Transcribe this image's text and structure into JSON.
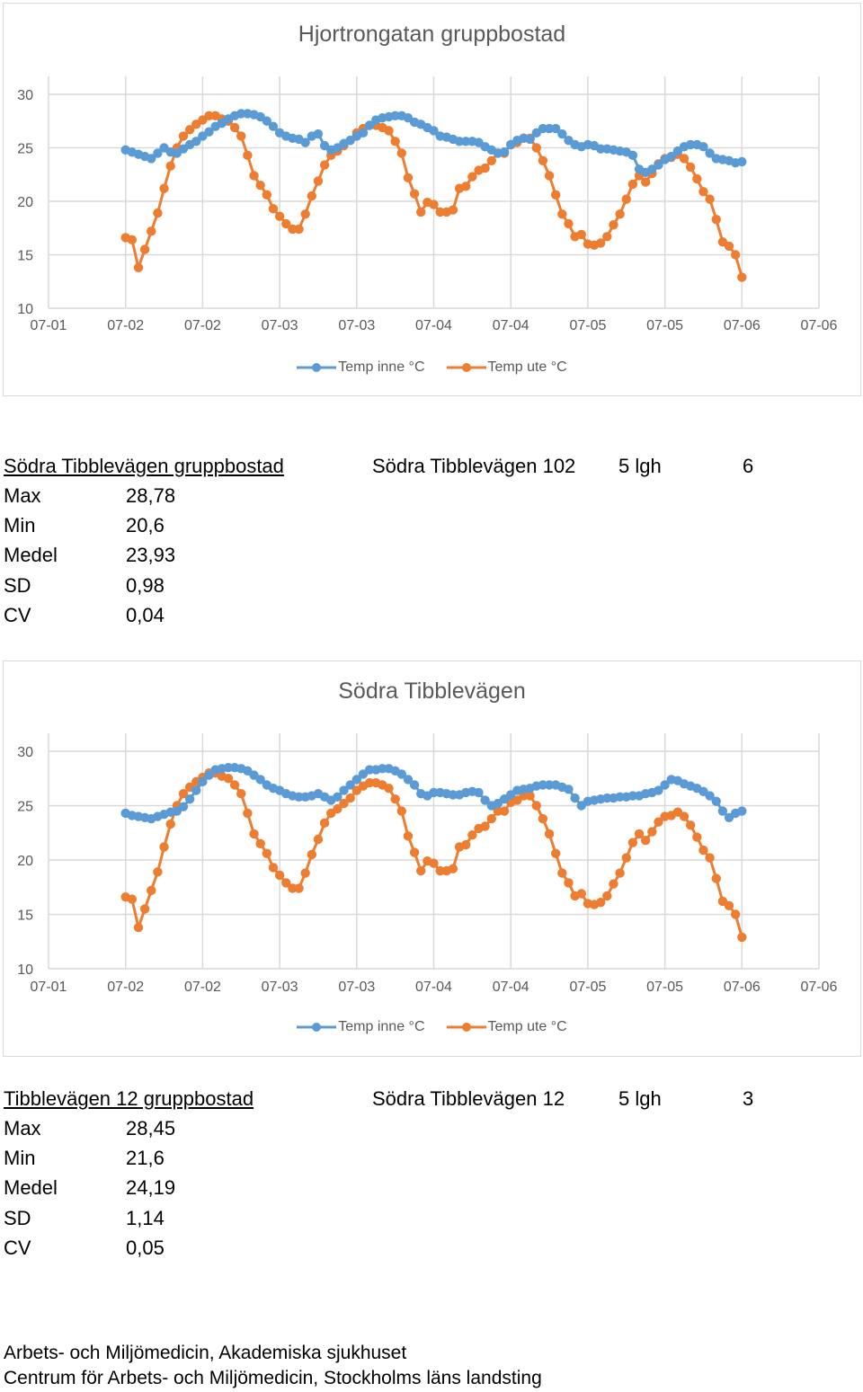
{
  "colors": {
    "inside": "#5b9bd5",
    "outside": "#ed7d31",
    "grid": "#d9d9d9",
    "axis_text": "#595959"
  },
  "chart_data": [
    {
      "type": "line",
      "title": "Hjortrongatan gruppbostad",
      "ylim": [
        10,
        30
      ],
      "yticks": [
        "10",
        "15",
        "20",
        "25",
        "30"
      ],
      "xtick_labels": [
        "07-01",
        "07-02",
        "07-02",
        "07-03",
        "07-03",
        "07-04",
        "07-04",
        "07-05",
        "07-05",
        "07-06",
        "07-06"
      ],
      "grid": true,
      "legend": "bottom",
      "series": [
        {
          "name": "Temp inne °C",
          "values": [
            24.8,
            24.6,
            24.4,
            24.2,
            24.0,
            24.5,
            25.0,
            24.6,
            24.5,
            24.9,
            25.3,
            25.6,
            26.1,
            26.5,
            27.0,
            27.3,
            27.7,
            28.0,
            28.2,
            28.2,
            28.1,
            27.9,
            27.5,
            27.0,
            26.4,
            26.1,
            25.9,
            25.8,
            25.5,
            26.1,
            26.3,
            25.2,
            24.8,
            25.0,
            25.4,
            25.7,
            26.1,
            26.4,
            27.1,
            27.6,
            27.8,
            27.9,
            28.0,
            28.0,
            27.8,
            27.4,
            27.2,
            26.9,
            26.6,
            26.1,
            26.0,
            25.8,
            25.6,
            25.6,
            25.6,
            25.5,
            25.1,
            24.8,
            24.5,
            24.6,
            25.3,
            25.7,
            25.9,
            25.8,
            26.4,
            26.8,
            26.8,
            26.8,
            26.3,
            25.7,
            25.3,
            25.1,
            25.3,
            25.2,
            24.9,
            24.9,
            24.8,
            24.7,
            24.6,
            24.3,
            23.0,
            22.7,
            23.0,
            23.4,
            23.9,
            24.2,
            24.7,
            25.1,
            25.3,
            25.3,
            25.1,
            24.5,
            24.0,
            23.9,
            23.8,
            23.6,
            23.7
          ]
        },
        {
          "name": "Temp ute °C",
          "values": [
            16.6,
            16.4,
            13.8,
            15.5,
            17.2,
            18.9,
            21.2,
            23.3,
            25.0,
            26.1,
            26.7,
            27.2,
            27.6,
            28.0,
            28.0,
            27.7,
            27.5,
            26.9,
            26.1,
            24.3,
            22.4,
            21.5,
            20.6,
            19.3,
            18.6,
            17.9,
            17.4,
            17.4,
            18.8,
            20.5,
            21.9,
            23.4,
            24.3,
            24.7,
            25.2,
            25.7,
            26.4,
            26.8,
            27.1,
            27.1,
            26.9,
            26.6,
            25.6,
            24.5,
            22.2,
            20.7,
            19.0,
            19.9,
            19.7,
            19.0,
            19.0,
            19.2,
            21.2,
            21.4,
            22.3,
            22.9,
            23.1,
            23.8,
            24.5,
            24.5,
            25.3,
            25.5,
            25.9,
            25.9,
            25.0,
            23.8,
            22.4,
            20.6,
            18.8,
            17.9,
            16.7,
            16.9,
            16.0,
            15.9,
            16.1,
            16.7,
            17.8,
            18.8,
            20.2,
            21.6,
            22.4,
            21.8,
            22.6,
            23.5,
            24.0,
            24.1,
            24.4,
            24.0,
            23.2,
            22.1,
            20.9,
            20.2,
            18.3,
            16.2,
            15.8,
            15.0,
            12.9
          ]
        }
      ]
    },
    {
      "type": "line",
      "title": "Södra Tibblevägen",
      "ylim": [
        10,
        30
      ],
      "yticks": [
        "10",
        "15",
        "20",
        "25",
        "30"
      ],
      "xtick_labels": [
        "07-01",
        "07-02",
        "07-02",
        "07-03",
        "07-03",
        "07-04",
        "07-04",
        "07-05",
        "07-05",
        "07-06",
        "07-06"
      ],
      "grid": true,
      "legend": "bottom",
      "series": [
        {
          "name": "Temp inne °C",
          "values": [
            24.3,
            24.1,
            24.0,
            23.9,
            23.8,
            24.0,
            24.2,
            24.4,
            24.5,
            24.9,
            25.6,
            26.4,
            27.2,
            27.8,
            28.3,
            28.4,
            28.5,
            28.5,
            28.4,
            28.2,
            27.8,
            27.4,
            26.9,
            26.6,
            26.4,
            26.1,
            25.9,
            25.8,
            25.8,
            25.9,
            26.1,
            25.8,
            25.5,
            25.8,
            26.4,
            26.9,
            27.4,
            27.9,
            28.3,
            28.3,
            28.4,
            28.4,
            28.2,
            27.9,
            27.4,
            26.9,
            26.1,
            25.9,
            26.2,
            26.2,
            26.1,
            26.0,
            26.0,
            26.2,
            26.3,
            26.2,
            25.5,
            25.0,
            25.2,
            25.6,
            26.0,
            26.4,
            26.5,
            26.6,
            26.8,
            26.9,
            26.9,
            26.9,
            26.7,
            26.5,
            25.7,
            25.0,
            25.4,
            25.5,
            25.6,
            25.7,
            25.7,
            25.8,
            25.8,
            25.9,
            25.9,
            26.1,
            26.2,
            26.4,
            26.9,
            27.4,
            27.3,
            27.0,
            26.8,
            26.6,
            26.3,
            25.9,
            25.4,
            24.5,
            23.9,
            24.3,
            24.5
          ]
        },
        {
          "name": "Temp ute °C",
          "values": [
            16.6,
            16.4,
            13.8,
            15.5,
            17.2,
            18.9,
            21.2,
            23.3,
            25.0,
            26.1,
            26.7,
            27.2,
            27.6,
            28.0,
            28.0,
            27.7,
            27.5,
            26.9,
            26.1,
            24.3,
            22.4,
            21.5,
            20.6,
            19.3,
            18.6,
            17.9,
            17.4,
            17.4,
            18.8,
            20.5,
            21.9,
            23.4,
            24.3,
            24.7,
            25.2,
            25.7,
            26.4,
            26.8,
            27.1,
            27.1,
            26.9,
            26.6,
            25.6,
            24.5,
            22.2,
            20.7,
            19.0,
            19.9,
            19.7,
            19.0,
            19.0,
            19.2,
            21.2,
            21.4,
            22.3,
            22.9,
            23.1,
            23.8,
            24.5,
            24.5,
            25.3,
            25.5,
            25.9,
            25.9,
            25.0,
            23.8,
            22.4,
            20.6,
            18.8,
            17.9,
            16.7,
            16.9,
            16.0,
            15.9,
            16.1,
            16.7,
            17.8,
            18.8,
            20.2,
            21.6,
            22.4,
            21.8,
            22.6,
            23.5,
            24.0,
            24.1,
            24.4,
            24.0,
            23.2,
            22.1,
            20.9,
            20.2,
            18.3,
            16.2,
            15.8,
            15.0,
            12.9
          ]
        }
      ]
    }
  ],
  "block1": {
    "heading": "Södra Tibblevägen gruppbostad",
    "address": "Södra Tibblevägen 102",
    "units": "5 lgh",
    "count": "6",
    "stats": [
      {
        "label": "Max",
        "value": "28,78"
      },
      {
        "label": "Min",
        "value": "20,6"
      },
      {
        "label": "Medel",
        "value": "23,93"
      },
      {
        "label": "SD",
        "value": "0,98"
      },
      {
        "label": "CV",
        "value": "0,04"
      }
    ]
  },
  "block2": {
    "heading": "Tibblevägen 12 gruppbostad",
    "address": "Södra Tibblevägen 12",
    "units": "5 lgh",
    "count": "3",
    "stats": [
      {
        "label": "Max",
        "value": "28,45"
      },
      {
        "label": "Min",
        "value": "21,6"
      },
      {
        "label": "Medel",
        "value": "24,19"
      },
      {
        "label": "SD",
        "value": "1,14"
      },
      {
        "label": "CV",
        "value": "0,05"
      }
    ]
  },
  "footer": [
    "Arbets- och Miljömedicin, Akademiska sjukhuset",
    "Centrum för Arbets- och Miljömedicin, Stockholms läns landsting"
  ]
}
